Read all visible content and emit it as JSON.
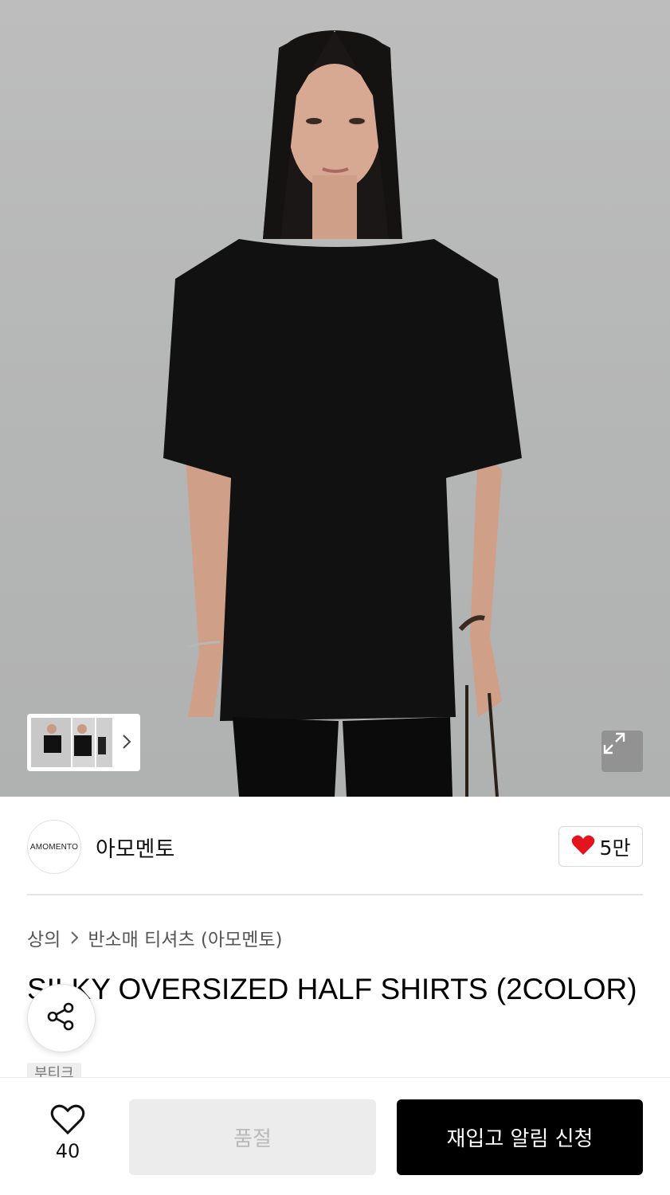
{
  "hero": {
    "image_alt": "",
    "icons": {
      "expand": "expand-icon",
      "thumbnail_next": "chevron-right-icon"
    }
  },
  "brand": {
    "logo_text": "AMOMENTO",
    "name": "아모멘토",
    "likes": "5만",
    "like_icon": "heart-filled-icon",
    "like_color": "#e3141d"
  },
  "breadcrumb": {
    "category": "상의",
    "subcategory": "반소매 티셔츠 (아모멘토)"
  },
  "product": {
    "title": "SILKY OVERSIZED HALF SHIRTS (2COLOR)",
    "tag": "부티크"
  },
  "share": {
    "icon": "share-icon"
  },
  "bottom_bar": {
    "wish_icon": "heart-outline-icon",
    "wish_count": "40",
    "soldout_label": "품절",
    "restock_label": "재입고 알림 신청"
  }
}
